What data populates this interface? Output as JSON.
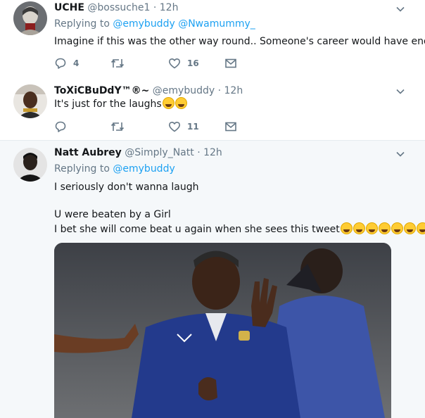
{
  "colors": {
    "accent": "#1da1f2",
    "muted": "#657786",
    "thread_line": "#c4e2f5",
    "highlight_bg": "#f5f8fa"
  },
  "tweets": [
    {
      "name": "UCHE",
      "handle": "@bossuche1",
      "dot": "·",
      "time": "12h",
      "replying_label": "Replying to",
      "replying_mentions": [
        "@emybuddy",
        "@Nwamummy_"
      ],
      "text": "Imagine if this was the other way round.. Someone's career would have ended.",
      "reply_count": "4",
      "retweet_count": "",
      "like_count": "16"
    },
    {
      "name": "ToXiCBuDdY™®~",
      "handle": "@emybuddy",
      "dot": "·",
      "time": "12h",
      "text": "It's just for the laughs",
      "emoji_icons": [
        "face-with-tears-of-joy-icon",
        "face-with-tears-of-joy-icon"
      ],
      "reply_count": "",
      "retweet_count": "",
      "like_count": "11"
    },
    {
      "name": "Natt Aubrey",
      "handle": "@Simply_Natt",
      "dot": "·",
      "time": "12h",
      "replying_label": "Replying to",
      "replying_mentions": [
        "@emybuddy"
      ],
      "text_line1": "I seriously don't wanna laugh",
      "text_line2": "U were beaten by a Girl",
      "text_line3": "I bet she will come beat u again when she sees this tweet",
      "emoji_icons": [
        "rolling-on-floor-laughing-icon",
        "rolling-on-floor-laughing-icon",
        "rolling-on-floor-laughing-icon",
        "rolling-on-floor-laughing-icon",
        "rolling-on-floor-laughing-icon",
        "rolling-on-floor-laughing-icon",
        "rolling-on-floor-laughing-icon"
      ]
    }
  ]
}
